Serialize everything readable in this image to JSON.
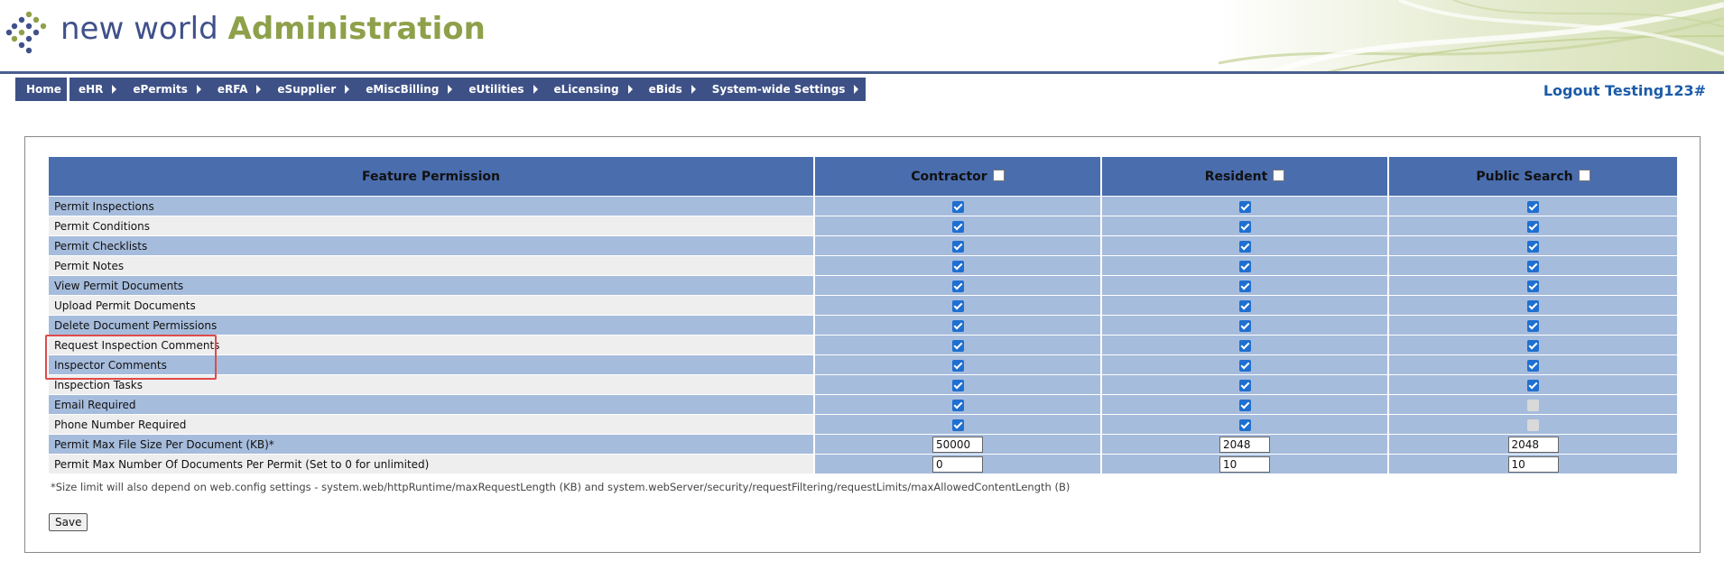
{
  "brand": {
    "name": "new world",
    "section": "Administration"
  },
  "nav": {
    "home": "Home",
    "items": [
      "eHR",
      "ePermits",
      "eRFA",
      "eSupplier",
      "eMiscBilling",
      "eUtilities",
      "eLicensing",
      "eBids",
      "System-wide Settings"
    ]
  },
  "logout": "Logout Testing123#",
  "table": {
    "headers": [
      "Feature Permission",
      "Contractor",
      "Resident",
      "Public Search"
    ],
    "rows": [
      {
        "label": "Permit Inspections",
        "values": [
          "checked",
          "checked",
          "checked"
        ]
      },
      {
        "label": "Permit Conditions",
        "values": [
          "checked",
          "checked",
          "checked"
        ]
      },
      {
        "label": "Permit Checklists",
        "values": [
          "checked",
          "checked",
          "checked"
        ]
      },
      {
        "label": "Permit Notes",
        "values": [
          "checked",
          "checked",
          "checked"
        ]
      },
      {
        "label": "View Permit Documents",
        "values": [
          "checked",
          "checked",
          "checked"
        ]
      },
      {
        "label": "Upload Permit Documents",
        "values": [
          "checked",
          "checked",
          "checked"
        ]
      },
      {
        "label": "Delete Document Permissions",
        "values": [
          "checked",
          "checked",
          "checked"
        ]
      },
      {
        "label": "Request Inspection Comments",
        "values": [
          "checked",
          "checked",
          "checked"
        ]
      },
      {
        "label": "Inspector Comments",
        "values": [
          "checked",
          "checked",
          "checked"
        ]
      },
      {
        "label": "Inspection Tasks",
        "values": [
          "checked",
          "checked",
          "checked"
        ]
      },
      {
        "label": "Email Required",
        "values": [
          "checked",
          "checked",
          "disabled"
        ]
      },
      {
        "label": "Phone Number Required",
        "values": [
          "checked",
          "checked",
          "disabled"
        ]
      }
    ],
    "input_rows": [
      {
        "label": "Permit Max File Size Per Document (KB)*",
        "values": [
          "50000",
          "2048",
          "2048"
        ]
      },
      {
        "label": "Permit Max Number Of Documents Per Permit (Set to 0 for unlimited)",
        "values": [
          "0",
          "10",
          "10"
        ]
      }
    ]
  },
  "note": "*Size limit will also depend on web.config settings - system.web/httpRuntime/maxRequestLength (KB) and system.webServer/security/requestFiltering/requestLimits/maxAllowedContentLength (B)",
  "save_label": "Save",
  "colors": {
    "header_blue": "#4a6dae",
    "row_blue": "#a6bcdc",
    "nav_blue": "#3e5187",
    "brand_blue": "#40508a",
    "brand_green": "#8ea04a",
    "highlight": "#e04a4a"
  }
}
